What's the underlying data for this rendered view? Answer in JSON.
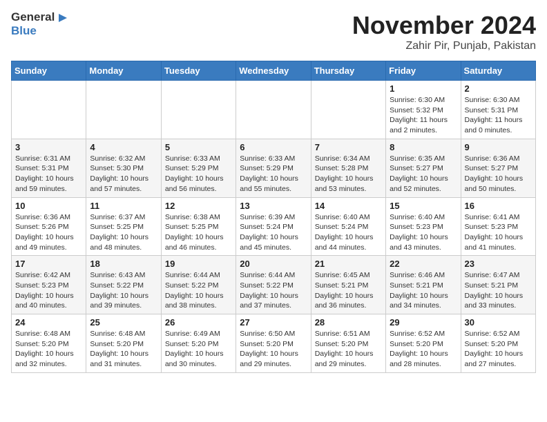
{
  "header": {
    "logo_general": "General",
    "logo_blue": "Blue",
    "month_year": "November 2024",
    "location": "Zahir Pir, Punjab, Pakistan"
  },
  "days_of_week": [
    "Sunday",
    "Monday",
    "Tuesday",
    "Wednesday",
    "Thursday",
    "Friday",
    "Saturday"
  ],
  "weeks": [
    [
      {
        "day": "",
        "info": ""
      },
      {
        "day": "",
        "info": ""
      },
      {
        "day": "",
        "info": ""
      },
      {
        "day": "",
        "info": ""
      },
      {
        "day": "",
        "info": ""
      },
      {
        "day": "1",
        "info": "Sunrise: 6:30 AM\nSunset: 5:32 PM\nDaylight: 11 hours\nand 2 minutes."
      },
      {
        "day": "2",
        "info": "Sunrise: 6:30 AM\nSunset: 5:31 PM\nDaylight: 11 hours\nand 0 minutes."
      }
    ],
    [
      {
        "day": "3",
        "info": "Sunrise: 6:31 AM\nSunset: 5:31 PM\nDaylight: 10 hours\nand 59 minutes."
      },
      {
        "day": "4",
        "info": "Sunrise: 6:32 AM\nSunset: 5:30 PM\nDaylight: 10 hours\nand 57 minutes."
      },
      {
        "day": "5",
        "info": "Sunrise: 6:33 AM\nSunset: 5:29 PM\nDaylight: 10 hours\nand 56 minutes."
      },
      {
        "day": "6",
        "info": "Sunrise: 6:33 AM\nSunset: 5:29 PM\nDaylight: 10 hours\nand 55 minutes."
      },
      {
        "day": "7",
        "info": "Sunrise: 6:34 AM\nSunset: 5:28 PM\nDaylight: 10 hours\nand 53 minutes."
      },
      {
        "day": "8",
        "info": "Sunrise: 6:35 AM\nSunset: 5:27 PM\nDaylight: 10 hours\nand 52 minutes."
      },
      {
        "day": "9",
        "info": "Sunrise: 6:36 AM\nSunset: 5:27 PM\nDaylight: 10 hours\nand 50 minutes."
      }
    ],
    [
      {
        "day": "10",
        "info": "Sunrise: 6:36 AM\nSunset: 5:26 PM\nDaylight: 10 hours\nand 49 minutes."
      },
      {
        "day": "11",
        "info": "Sunrise: 6:37 AM\nSunset: 5:25 PM\nDaylight: 10 hours\nand 48 minutes."
      },
      {
        "day": "12",
        "info": "Sunrise: 6:38 AM\nSunset: 5:25 PM\nDaylight: 10 hours\nand 46 minutes."
      },
      {
        "day": "13",
        "info": "Sunrise: 6:39 AM\nSunset: 5:24 PM\nDaylight: 10 hours\nand 45 minutes."
      },
      {
        "day": "14",
        "info": "Sunrise: 6:40 AM\nSunset: 5:24 PM\nDaylight: 10 hours\nand 44 minutes."
      },
      {
        "day": "15",
        "info": "Sunrise: 6:40 AM\nSunset: 5:23 PM\nDaylight: 10 hours\nand 43 minutes."
      },
      {
        "day": "16",
        "info": "Sunrise: 6:41 AM\nSunset: 5:23 PM\nDaylight: 10 hours\nand 41 minutes."
      }
    ],
    [
      {
        "day": "17",
        "info": "Sunrise: 6:42 AM\nSunset: 5:23 PM\nDaylight: 10 hours\nand 40 minutes."
      },
      {
        "day": "18",
        "info": "Sunrise: 6:43 AM\nSunset: 5:22 PM\nDaylight: 10 hours\nand 39 minutes."
      },
      {
        "day": "19",
        "info": "Sunrise: 6:44 AM\nSunset: 5:22 PM\nDaylight: 10 hours\nand 38 minutes."
      },
      {
        "day": "20",
        "info": "Sunrise: 6:44 AM\nSunset: 5:22 PM\nDaylight: 10 hours\nand 37 minutes."
      },
      {
        "day": "21",
        "info": "Sunrise: 6:45 AM\nSunset: 5:21 PM\nDaylight: 10 hours\nand 36 minutes."
      },
      {
        "day": "22",
        "info": "Sunrise: 6:46 AM\nSunset: 5:21 PM\nDaylight: 10 hours\nand 34 minutes."
      },
      {
        "day": "23",
        "info": "Sunrise: 6:47 AM\nSunset: 5:21 PM\nDaylight: 10 hours\nand 33 minutes."
      }
    ],
    [
      {
        "day": "24",
        "info": "Sunrise: 6:48 AM\nSunset: 5:20 PM\nDaylight: 10 hours\nand 32 minutes."
      },
      {
        "day": "25",
        "info": "Sunrise: 6:48 AM\nSunset: 5:20 PM\nDaylight: 10 hours\nand 31 minutes."
      },
      {
        "day": "26",
        "info": "Sunrise: 6:49 AM\nSunset: 5:20 PM\nDaylight: 10 hours\nand 30 minutes."
      },
      {
        "day": "27",
        "info": "Sunrise: 6:50 AM\nSunset: 5:20 PM\nDaylight: 10 hours\nand 29 minutes."
      },
      {
        "day": "28",
        "info": "Sunrise: 6:51 AM\nSunset: 5:20 PM\nDaylight: 10 hours\nand 29 minutes."
      },
      {
        "day": "29",
        "info": "Sunrise: 6:52 AM\nSunset: 5:20 PM\nDaylight: 10 hours\nand 28 minutes."
      },
      {
        "day": "30",
        "info": "Sunrise: 6:52 AM\nSunset: 5:20 PM\nDaylight: 10 hours\nand 27 minutes."
      }
    ]
  ]
}
